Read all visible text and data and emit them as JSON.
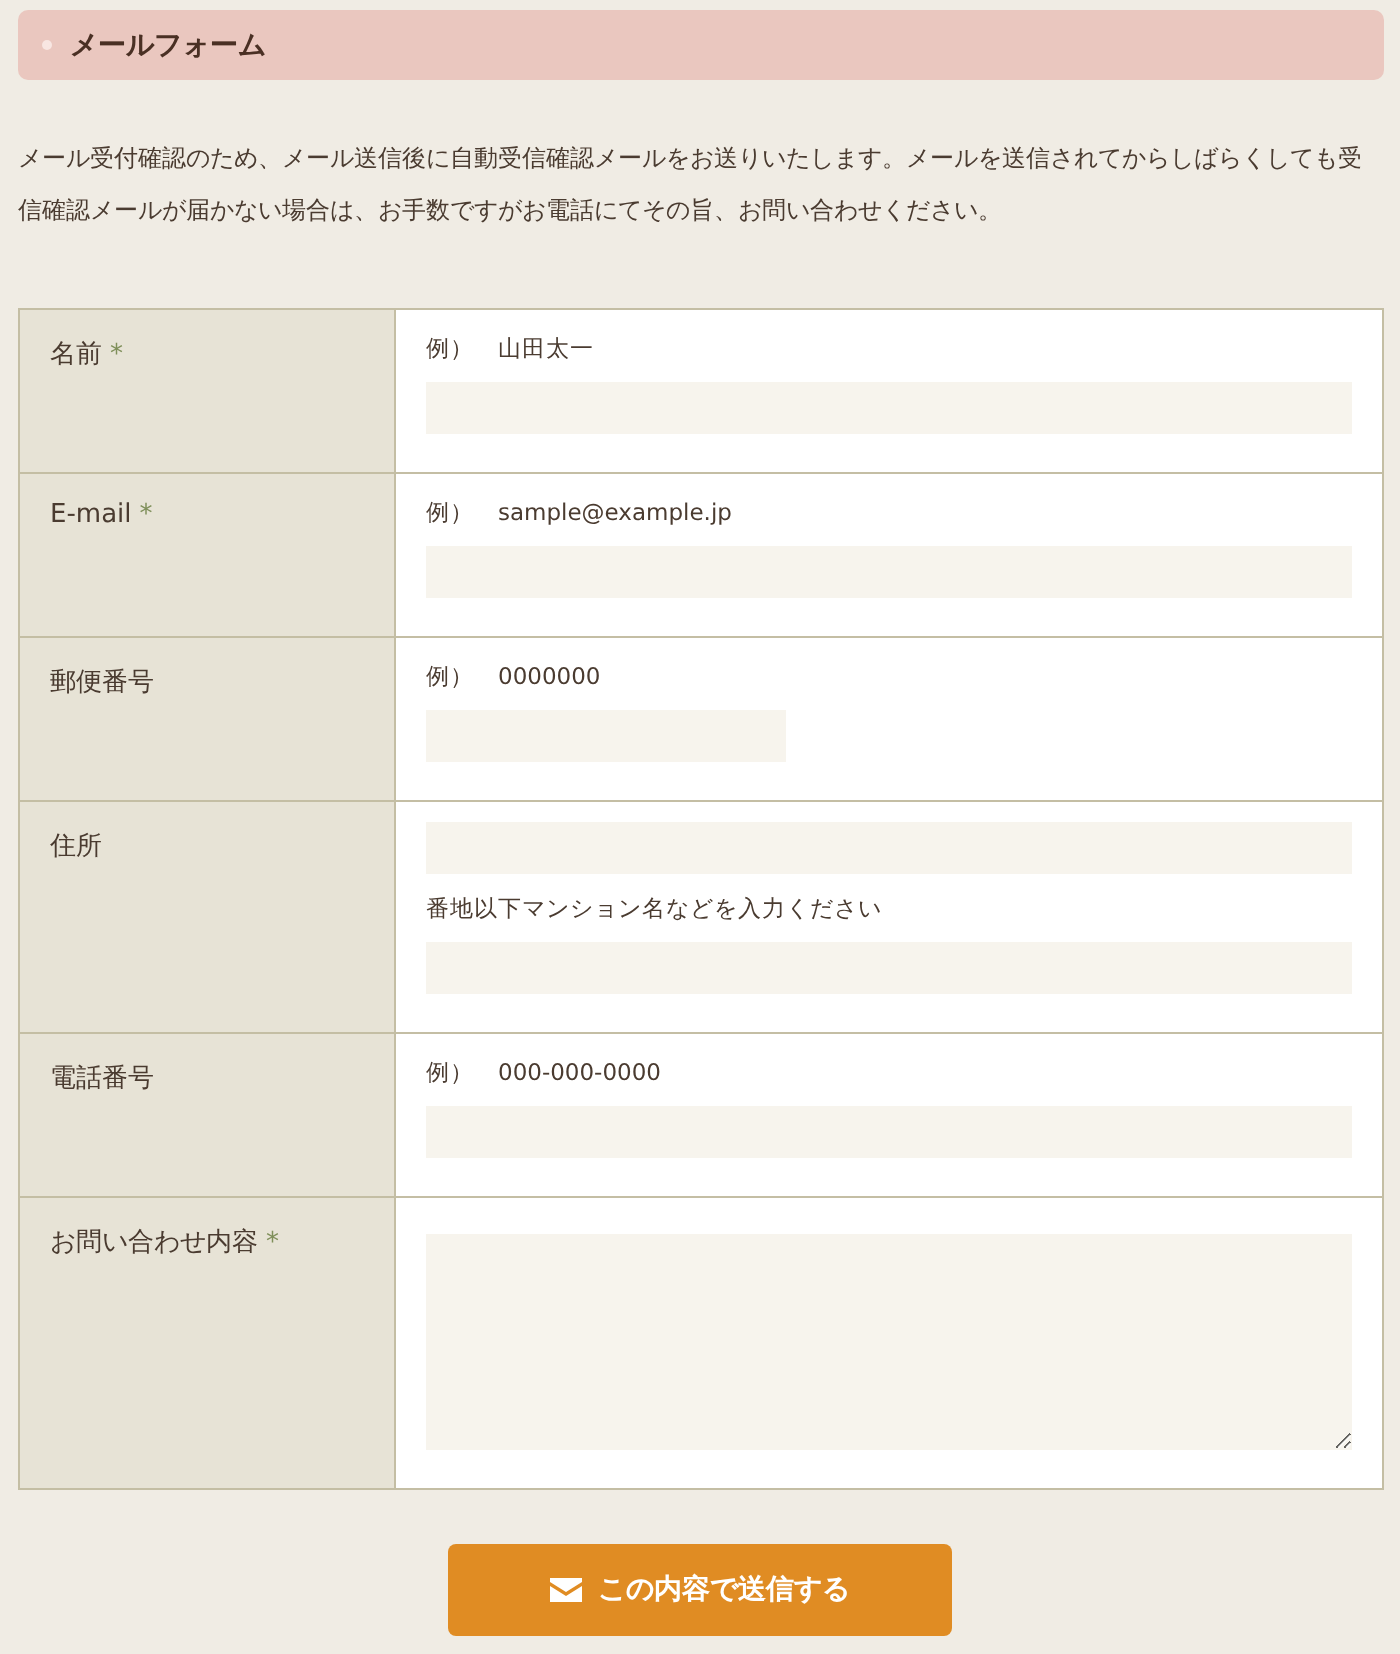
{
  "heading": {
    "title": "メールフォーム"
  },
  "intro": "メール受付確認のため、メール送信後に自動受信確認メールをお送りいたします。メールを送信されてからしばらくしても受信確認メールが届かない場合は、お手数ですがお電話にてその旨、お問い合わせください。",
  "rows": [
    {
      "label": "名前",
      "required_mark": "*",
      "parts": [
        {
          "kind": "hint",
          "text": "例）　山田太一"
        },
        {
          "kind": "input"
        }
      ]
    },
    {
      "label": "E-mail",
      "required_mark": "*",
      "parts": [
        {
          "kind": "hint",
          "text": "例）　sample@example.jp"
        },
        {
          "kind": "input"
        }
      ]
    },
    {
      "label": "郵便番号",
      "parts": [
        {
          "kind": "hint",
          "text": "例）　0000000"
        },
        {
          "kind": "short_input"
        }
      ]
    },
    {
      "label": "住所",
      "parts": [
        {
          "kind": "input"
        },
        {
          "kind": "hint",
          "text": "番地以下マンション名などを入力ください"
        },
        {
          "kind": "input"
        }
      ]
    },
    {
      "label": "電話番号",
      "parts": [
        {
          "kind": "hint",
          "text": "例）　000-000-0000"
        },
        {
          "kind": "input"
        }
      ]
    },
    {
      "label": "お問い合わせ内容",
      "required_mark": "*",
      "parts": [
        {
          "kind": "textarea"
        }
      ]
    }
  ],
  "submit": {
    "label": "この内容で送信する"
  }
}
